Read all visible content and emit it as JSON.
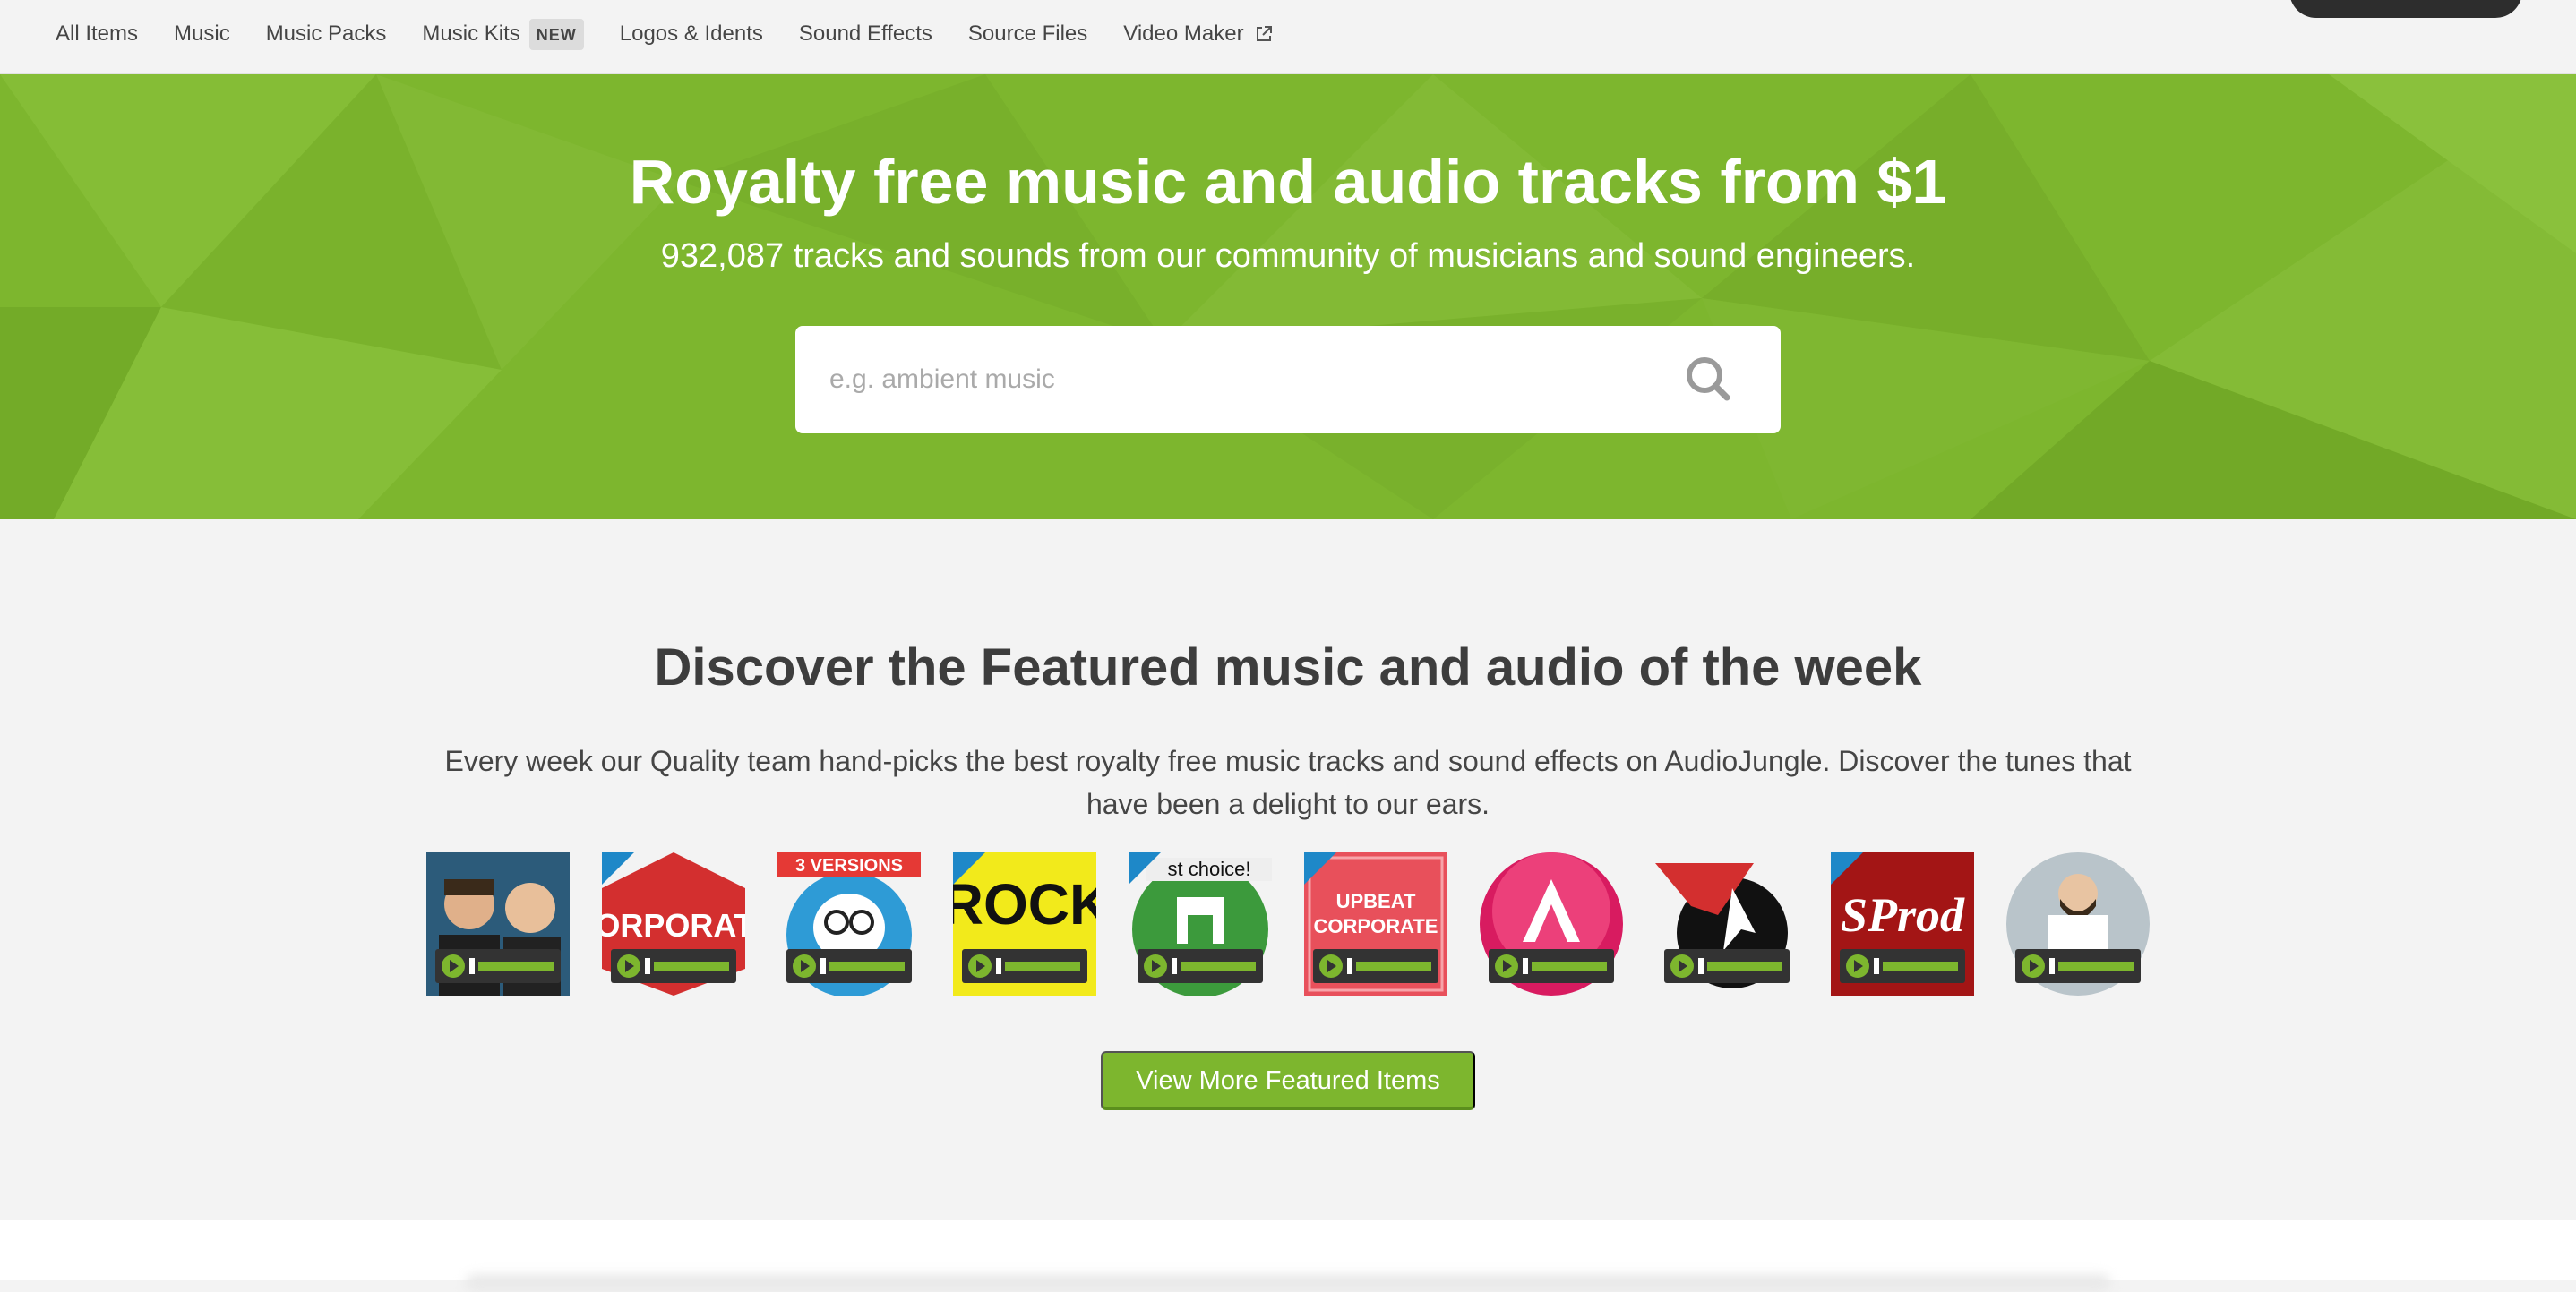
{
  "nav": {
    "items": [
      {
        "label": "All Items"
      },
      {
        "label": "Music"
      },
      {
        "label": "Music Packs"
      },
      {
        "label": "Music Kits",
        "badge": "NEW"
      },
      {
        "label": "Logos & Idents"
      },
      {
        "label": "Sound Effects"
      },
      {
        "label": "Source Files"
      },
      {
        "label": "Video Maker",
        "icon": "external-link-icon"
      }
    ]
  },
  "hero": {
    "title": "Royalty free music and audio tracks from $1",
    "subtitle": "932,087 tracks and sounds from our community of musicians and sound engineers.",
    "search_placeholder": "e.g. ambient music",
    "bg_color": "#7db62e"
  },
  "featured": {
    "title": "Discover the Featured music and audio of the week",
    "description": "Every week our Quality team hand-picks the best royalty free music tracks and sound effects on AudioJungle. Discover the tunes that have been a delight to our ears.",
    "thumbnails": [
      {
        "name": "two-men-portrait",
        "text": ""
      },
      {
        "name": "corporate",
        "text": "CORPORATE"
      },
      {
        "name": "3-versions-cartoon",
        "text": "3 VERSIONS"
      },
      {
        "name": "rock",
        "text": "ROCK"
      },
      {
        "name": "best-choice",
        "text": "st choice!"
      },
      {
        "name": "upbeat-corporate",
        "text": "UPBEAT CORPORATE"
      },
      {
        "name": "letter-a-logo",
        "text": ""
      },
      {
        "name": "tk-logo",
        "text": ""
      },
      {
        "name": "sprod",
        "text": "SProd"
      },
      {
        "name": "bearded-man",
        "text": ""
      }
    ],
    "view_more_label": "View More Featured Items",
    "accent_color": "#7db62e"
  }
}
